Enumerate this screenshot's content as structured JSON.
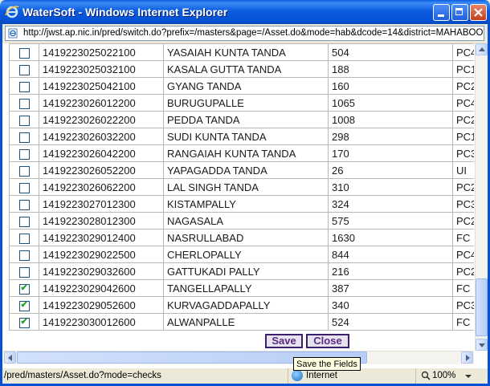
{
  "window": {
    "title": "WaterSoft - Windows Internet Explorer"
  },
  "address": {
    "url": "http://jwst.ap.nic.in/pred/switch.do?prefix=/masters&page=/Asset.do&mode=hab&dcode=14&district=MAHABOOBNAGAR"
  },
  "table": {
    "rows": [
      {
        "checked": false,
        "code": "1419223025022100",
        "name": "YASAIAH KUNTA TANDA",
        "value": "504",
        "type": "PC4"
      },
      {
        "checked": false,
        "code": "1419223025032100",
        "name": "KASALA GUTTA TANDA",
        "value": "188",
        "type": "PC1"
      },
      {
        "checked": false,
        "code": "1419223025042100",
        "name": "GYANG TANDA",
        "value": "160",
        "type": "PC2"
      },
      {
        "checked": false,
        "code": "1419223026012200",
        "name": "BURUGUPALLE",
        "value": "1065",
        "type": "PC4"
      },
      {
        "checked": false,
        "code": "1419223026022200",
        "name": "PEDDA TANDA",
        "value": "1008",
        "type": "PC2"
      },
      {
        "checked": false,
        "code": "1419223026032200",
        "name": "SUDI KUNTA TANDA",
        "value": "298",
        "type": "PC1"
      },
      {
        "checked": false,
        "code": "1419223026042200",
        "name": "RANGAIAH KUNTA TANDA",
        "value": "170",
        "type": "PC3"
      },
      {
        "checked": false,
        "code": "1419223026052200",
        "name": "YAPAGADDA TANDA",
        "value": "26",
        "type": "UI"
      },
      {
        "checked": false,
        "code": "1419223026062200",
        "name": "LAL SINGH TANDA",
        "value": "310",
        "type": "PC2"
      },
      {
        "checked": false,
        "code": "1419223027012300",
        "name": "KISTAMPALLY",
        "value": "324",
        "type": "PC3"
      },
      {
        "checked": false,
        "code": "1419223028012300",
        "name": "NAGASALA",
        "value": "575",
        "type": "PC2"
      },
      {
        "checked": false,
        "code": "1419223029012400",
        "name": "NASRULLABAD",
        "value": "1630",
        "type": "FC"
      },
      {
        "checked": false,
        "code": "1419223029022500",
        "name": "CHERLOPALLY",
        "value": "844",
        "type": "PC4"
      },
      {
        "checked": false,
        "code": "1419223029032600",
        "name": "GATTUKADI PALLY",
        "value": "216",
        "type": "PC2"
      },
      {
        "checked": true,
        "code": "1419223029042600",
        "name": "TANGELLAPALLY",
        "value": "387",
        "type": "FC"
      },
      {
        "checked": true,
        "code": "1419223029052600",
        "name": "KURVAGADDAPALLY",
        "value": "340",
        "type": "PC3"
      },
      {
        "checked": true,
        "code": "1419223030012600",
        "name": "ALWANPALLE",
        "value": "524",
        "type": "FC"
      }
    ]
  },
  "buttons": {
    "save_label": "Save",
    "close_label": "Close"
  },
  "tooltip": {
    "text": "Save the Fields"
  },
  "status": {
    "text": "/pred/masters/Asset.do?mode=checks",
    "zone": "Internet",
    "zoom": "100%"
  },
  "colors": {
    "titlebar": "#0651d4",
    "button_text": "#5b2a86",
    "check": "#21a121"
  },
  "icons": [
    "ie-logo-icon",
    "minimize-icon",
    "maximize-icon",
    "close-icon",
    "page-icon",
    "globe-icon",
    "zoom-icon"
  ]
}
